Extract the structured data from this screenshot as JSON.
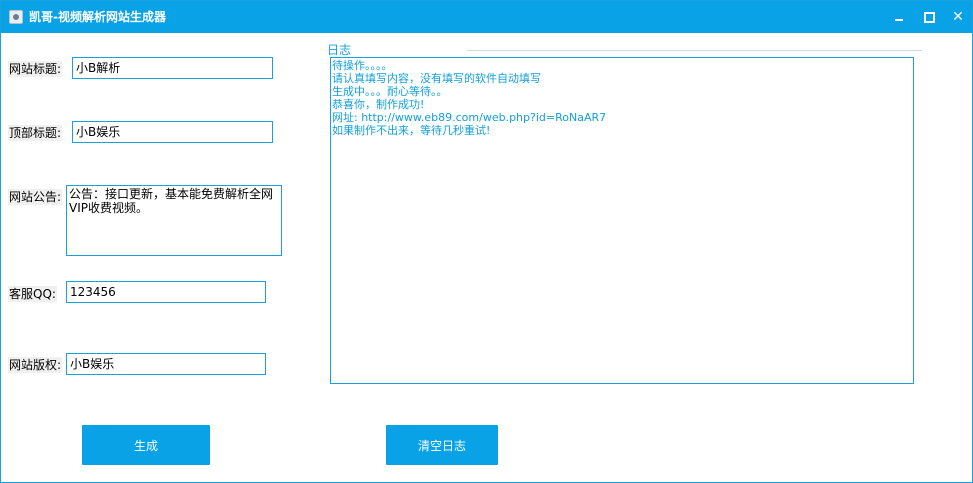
{
  "window": {
    "title": "凯哥-视频解析网站生成器",
    "controls": {
      "minimize": "",
      "maximize": "",
      "close": "✕"
    }
  },
  "form": {
    "site_title_label": "网站标题:",
    "site_title_value": "小B解析",
    "top_title_label": "顶部标题:",
    "top_title_value": "小B娱乐",
    "notice_label": "网站公告:",
    "notice_value": "公告：接口更新，基本能免费解析全网VIP收费视频。",
    "qq_label": "客服QQ:",
    "qq_value": "123456",
    "copyright_label": "网站版权:",
    "copyright_value": "小B娱乐"
  },
  "log": {
    "legend": "日志",
    "lines": [
      "待操作。。。。",
      "请认真填写内容，没有填写的软件自动填写",
      "生成中。。。耐心等待。。",
      "恭喜你，制作成功!",
      "网址: http://www.eb89.com/web.php?id=RoNaAR7",
      "如果制作不出来，等待几秒重试!"
    ]
  },
  "buttons": {
    "generate": "生成",
    "clear_log": "清空日志"
  },
  "colors": {
    "accent": "#0aa2e6",
    "border": "#1aa0dd",
    "log_text": "#13a0d8"
  }
}
